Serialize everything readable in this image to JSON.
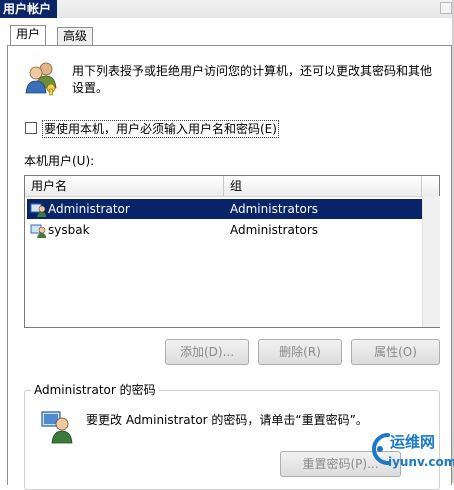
{
  "window": {
    "title": "用户帐户"
  },
  "tabs": [
    {
      "label": "用户",
      "active": true
    },
    {
      "label": "高级",
      "active": false
    }
  ],
  "intro_text": "用下列表授予或拒绝用户访问您的计算机，还可以更改其密码和其他设置。",
  "require_password": {
    "label": "要使用本机，用户必须输入用户名和密码(E)",
    "checked": false
  },
  "users_section": {
    "label": "本机用户(U):",
    "columns": [
      "用户名",
      "组"
    ],
    "rows": [
      {
        "name": "Administrator",
        "group": "Administrators",
        "selected": true
      },
      {
        "name": "sysbak",
        "group": "Administrators",
        "selected": false
      }
    ]
  },
  "buttons": {
    "add": "添加(D)...",
    "remove": "删除(R)",
    "properties": "属性(O)"
  },
  "password_group": {
    "title": "Administrator 的密码",
    "text": "要更改 Administrator 的密码，请单击“重置密码”。",
    "reset_button": "重置密码(P)..."
  },
  "watermark": {
    "brand": "运维网",
    "url": "iyunv.com"
  },
  "colors": {
    "selection": "#0a246a",
    "watermark_blue": "#1a78c8"
  }
}
